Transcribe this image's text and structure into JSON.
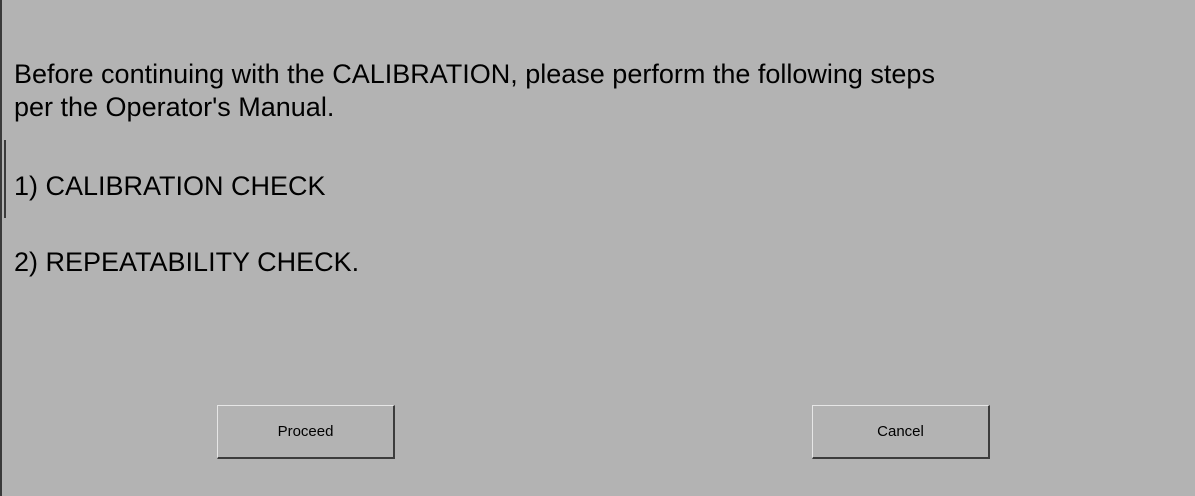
{
  "dialog": {
    "message_line1": "Before continuing with the CALIBRATION, please perform the following steps",
    "message_line2": "per the Operator's Manual.",
    "steps": [
      "1) CALIBRATION CHECK",
      "2) REPEATABILITY CHECK."
    ],
    "buttons": {
      "proceed_label": "Proceed",
      "cancel_label": "Cancel"
    },
    "colors": {
      "background": "#b3b3b3",
      "text": "#000000"
    }
  }
}
